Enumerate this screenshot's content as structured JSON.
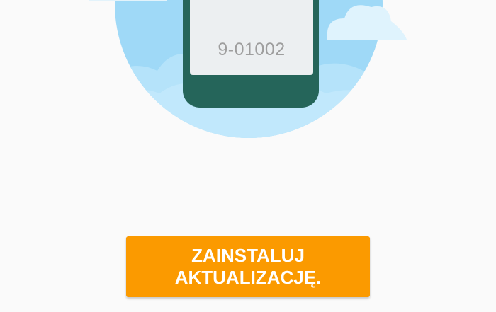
{
  "device": {
    "version": "9-01002"
  },
  "actions": {
    "install_line1": "ZAINSTALUJ",
    "install_line2": "AKTUALIZACJĘ."
  },
  "colors": {
    "background": "#fafafa",
    "sky_circle": "#9fd9f7",
    "cloud": "#dff3fd",
    "phone_body": "#25655a",
    "phone_screen": "#eceff1",
    "button": "#fb9a00",
    "button_text": "#ffffff",
    "version_text": "#9e9e9e"
  }
}
